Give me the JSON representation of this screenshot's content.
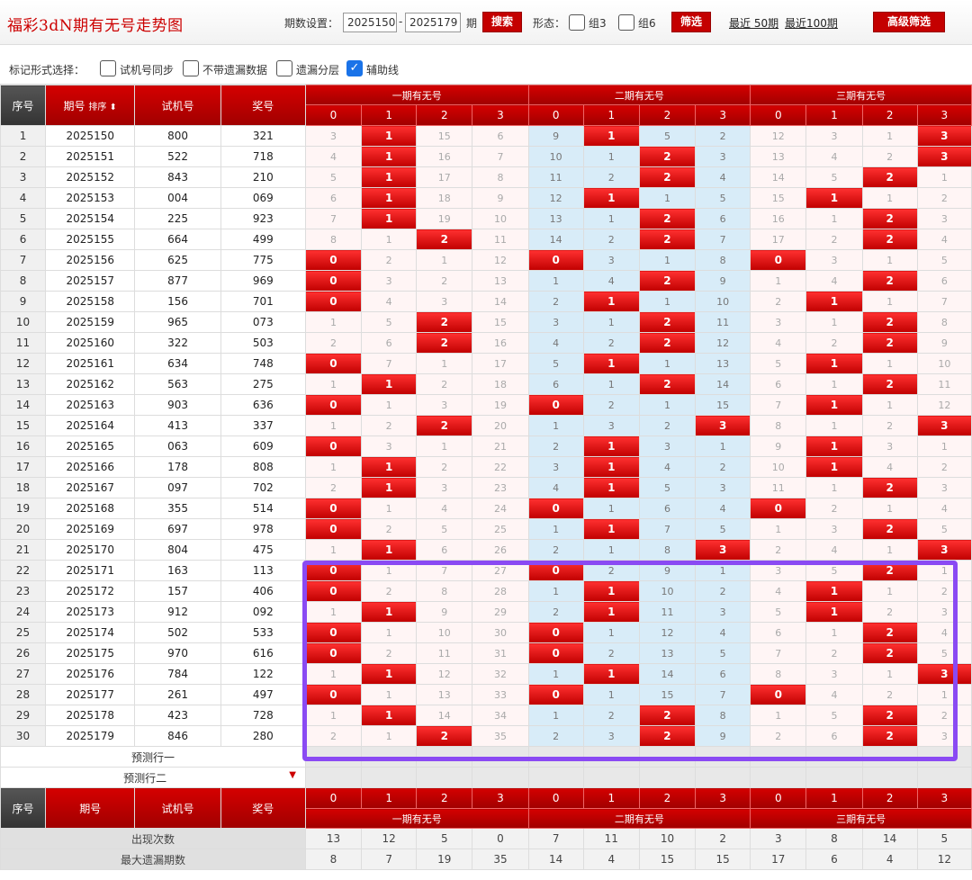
{
  "title": "福彩3dN期有无号走势图",
  "toolbar": {
    "period_label": "期数设置：",
    "from": "2025150",
    "dash": "-",
    "to": "2025179",
    "period_unit": "期",
    "search_label": "搜索",
    "shape_label": "形态：",
    "group3_label": "组3",
    "group6_label": "组6",
    "filter_label": "筛选",
    "recent50_label": "最近 50期",
    "recent100_label": "最近100期",
    "advanced_label": "高级筛选"
  },
  "markbar": {
    "label": "标记形式选择：",
    "options": [
      {
        "label": "试机号同步",
        "checked": false
      },
      {
        "label": "不带遗漏数据",
        "checked": false
      },
      {
        "label": "遗漏分层",
        "checked": false
      },
      {
        "label": "辅助线",
        "checked": true
      }
    ]
  },
  "header": {
    "seq": "序号",
    "period": "期号",
    "sort": "排序",
    "trial": "试机号",
    "prize": "奖号",
    "groups": [
      "一期有无号",
      "二期有无号",
      "三期有无号"
    ],
    "digits": [
      "0",
      "1",
      "2",
      "3"
    ]
  },
  "rows": [
    {
      "seq": "1",
      "period": "2025150",
      "trial": "800",
      "prize": "321",
      "cells": [
        "3",
        "1",
        "15",
        "6",
        "9",
        "1",
        "5",
        "2",
        "12",
        "3",
        "1",
        "3"
      ],
      "hits": [
        1,
        5,
        11
      ]
    },
    {
      "seq": "2",
      "period": "2025151",
      "trial": "522",
      "prize": "718",
      "cells": [
        "4",
        "1",
        "16",
        "7",
        "10",
        "1",
        "2",
        "3",
        "13",
        "4",
        "2",
        "3"
      ],
      "hits": [
        1,
        6,
        11
      ]
    },
    {
      "seq": "3",
      "period": "2025152",
      "trial": "843",
      "prize": "210",
      "cells": [
        "5",
        "1",
        "17",
        "8",
        "11",
        "2",
        "2",
        "4",
        "14",
        "5",
        "2",
        "1"
      ],
      "hits": [
        1,
        6,
        10
      ]
    },
    {
      "seq": "4",
      "period": "2025153",
      "trial": "004",
      "prize": "069",
      "cells": [
        "6",
        "1",
        "18",
        "9",
        "12",
        "1",
        "1",
        "5",
        "15",
        "1",
        "1",
        "2"
      ],
      "hits": [
        1,
        5,
        9
      ]
    },
    {
      "seq": "5",
      "period": "2025154",
      "trial": "225",
      "prize": "923",
      "cells": [
        "7",
        "1",
        "19",
        "10",
        "13",
        "1",
        "2",
        "6",
        "16",
        "1",
        "2",
        "3"
      ],
      "hits": [
        1,
        6,
        10
      ]
    },
    {
      "seq": "6",
      "period": "2025155",
      "trial": "664",
      "prize": "499",
      "cells": [
        "8",
        "1",
        "2",
        "11",
        "14",
        "2",
        "2",
        "7",
        "17",
        "2",
        "2",
        "4"
      ],
      "hits": [
        2,
        6,
        10
      ],
      "grpend": true
    },
    {
      "seq": "7",
      "period": "2025156",
      "trial": "625",
      "prize": "775",
      "cells": [
        "0",
        "2",
        "1",
        "12",
        "0",
        "3",
        "1",
        "8",
        "0",
        "3",
        "1",
        "5"
      ],
      "hits": [
        0,
        4,
        8
      ]
    },
    {
      "seq": "8",
      "period": "2025157",
      "trial": "877",
      "prize": "969",
      "cells": [
        "0",
        "3",
        "2",
        "13",
        "1",
        "4",
        "2",
        "9",
        "1",
        "4",
        "2",
        "6"
      ],
      "hits": [
        0,
        6,
        10
      ]
    },
    {
      "seq": "9",
      "period": "2025158",
      "trial": "156",
      "prize": "701",
      "cells": [
        "0",
        "4",
        "3",
        "14",
        "2",
        "1",
        "1",
        "10",
        "2",
        "1",
        "1",
        "7"
      ],
      "hits": [
        0,
        5,
        9
      ]
    },
    {
      "seq": "10",
      "period": "2025159",
      "trial": "965",
      "prize": "073",
      "cells": [
        "1",
        "5",
        "2",
        "15",
        "3",
        "1",
        "2",
        "11",
        "3",
        "1",
        "2",
        "8"
      ],
      "hits": [
        2,
        6,
        10
      ]
    },
    {
      "seq": "11",
      "period": "2025160",
      "trial": "322",
      "prize": "503",
      "cells": [
        "2",
        "6",
        "2",
        "16",
        "4",
        "2",
        "2",
        "12",
        "4",
        "2",
        "2",
        "9"
      ],
      "hits": [
        2,
        6,
        10
      ]
    },
    {
      "seq": "12",
      "period": "2025161",
      "trial": "634",
      "prize": "748",
      "cells": [
        "0",
        "7",
        "1",
        "17",
        "5",
        "1",
        "1",
        "13",
        "5",
        "1",
        "1",
        "10"
      ],
      "hits": [
        0,
        5,
        9
      ],
      "grpend": true
    },
    {
      "seq": "13",
      "period": "2025162",
      "trial": "563",
      "prize": "275",
      "cells": [
        "1",
        "1",
        "2",
        "18",
        "6",
        "1",
        "2",
        "14",
        "6",
        "1",
        "2",
        "11"
      ],
      "hits": [
        1,
        6,
        10
      ]
    },
    {
      "seq": "14",
      "period": "2025163",
      "trial": "903",
      "prize": "636",
      "cells": [
        "0",
        "1",
        "3",
        "19",
        "0",
        "2",
        "1",
        "15",
        "7",
        "1",
        "1",
        "12"
      ],
      "hits": [
        0,
        4,
        9
      ]
    },
    {
      "seq": "15",
      "period": "2025164",
      "trial": "413",
      "prize": "337",
      "cells": [
        "1",
        "2",
        "2",
        "20",
        "1",
        "3",
        "2",
        "3",
        "8",
        "1",
        "2",
        "3"
      ],
      "hits": [
        2,
        7,
        11
      ]
    },
    {
      "seq": "16",
      "period": "2025165",
      "trial": "063",
      "prize": "609",
      "cells": [
        "0",
        "3",
        "1",
        "21",
        "2",
        "1",
        "3",
        "1",
        "9",
        "1",
        "3",
        "1"
      ],
      "hits": [
        0,
        5,
        9
      ]
    },
    {
      "seq": "17",
      "period": "2025166",
      "trial": "178",
      "prize": "808",
      "cells": [
        "1",
        "1",
        "2",
        "22",
        "3",
        "1",
        "4",
        "2",
        "10",
        "1",
        "4",
        "2"
      ],
      "hits": [
        1,
        5,
        9
      ]
    },
    {
      "seq": "18",
      "period": "2025167",
      "trial": "097",
      "prize": "702",
      "cells": [
        "2",
        "1",
        "3",
        "23",
        "4",
        "1",
        "5",
        "3",
        "11",
        "1",
        "2",
        "3"
      ],
      "hits": [
        1,
        5,
        10
      ],
      "grpend": true
    },
    {
      "seq": "19",
      "period": "2025168",
      "trial": "355",
      "prize": "514",
      "cells": [
        "0",
        "1",
        "4",
        "24",
        "0",
        "1",
        "6",
        "4",
        "0",
        "2",
        "1",
        "4"
      ],
      "hits": [
        0,
        4,
        8
      ]
    },
    {
      "seq": "20",
      "period": "2025169",
      "trial": "697",
      "prize": "978",
      "cells": [
        "0",
        "2",
        "5",
        "25",
        "1",
        "1",
        "7",
        "5",
        "1",
        "3",
        "2",
        "5"
      ],
      "hits": [
        0,
        5,
        10
      ]
    },
    {
      "seq": "21",
      "period": "2025170",
      "trial": "804",
      "prize": "475",
      "cells": [
        "1",
        "1",
        "6",
        "26",
        "2",
        "1",
        "8",
        "3",
        "2",
        "4",
        "1",
        "3"
      ],
      "hits": [
        1,
        7,
        11
      ]
    },
    {
      "seq": "22",
      "period": "2025171",
      "trial": "163",
      "prize": "113",
      "cells": [
        "0",
        "1",
        "7",
        "27",
        "0",
        "2",
        "9",
        "1",
        "3",
        "5",
        "2",
        "1"
      ],
      "hits": [
        0,
        4,
        10
      ]
    },
    {
      "seq": "23",
      "period": "2025172",
      "trial": "157",
      "prize": "406",
      "cells": [
        "0",
        "2",
        "8",
        "28",
        "1",
        "1",
        "10",
        "2",
        "4",
        "1",
        "1",
        "2"
      ],
      "hits": [
        0,
        5,
        9
      ]
    },
    {
      "seq": "24",
      "period": "2025173",
      "trial": "912",
      "prize": "092",
      "cells": [
        "1",
        "1",
        "9",
        "29",
        "2",
        "1",
        "11",
        "3",
        "5",
        "1",
        "2",
        "3"
      ],
      "hits": [
        1,
        5,
        9
      ],
      "grpend": true
    },
    {
      "seq": "25",
      "period": "2025174",
      "trial": "502",
      "prize": "533",
      "cells": [
        "0",
        "1",
        "10",
        "30",
        "0",
        "1",
        "12",
        "4",
        "6",
        "1",
        "2",
        "4"
      ],
      "hits": [
        0,
        4,
        10
      ]
    },
    {
      "seq": "26",
      "period": "2025175",
      "trial": "970",
      "prize": "616",
      "cells": [
        "0",
        "2",
        "11",
        "31",
        "0",
        "2",
        "13",
        "5",
        "7",
        "2",
        "2",
        "5"
      ],
      "hits": [
        0,
        4,
        10
      ]
    },
    {
      "seq": "27",
      "period": "2025176",
      "trial": "784",
      "prize": "122",
      "cells": [
        "1",
        "1",
        "12",
        "32",
        "1",
        "1",
        "14",
        "6",
        "8",
        "3",
        "1",
        "3"
      ],
      "hits": [
        1,
        5,
        11
      ]
    },
    {
      "seq": "28",
      "period": "2025177",
      "trial": "261",
      "prize": "497",
      "cells": [
        "0",
        "1",
        "13",
        "33",
        "0",
        "1",
        "15",
        "7",
        "0",
        "4",
        "2",
        "1"
      ],
      "hits": [
        0,
        4,
        8
      ]
    },
    {
      "seq": "29",
      "period": "2025178",
      "trial": "423",
      "prize": "728",
      "cells": [
        "1",
        "1",
        "14",
        "34",
        "1",
        "2",
        "2",
        "8",
        "1",
        "5",
        "2",
        "2"
      ],
      "hits": [
        1,
        6,
        10
      ]
    },
    {
      "seq": "30",
      "period": "2025179",
      "trial": "846",
      "prize": "280",
      "cells": [
        "2",
        "1",
        "2",
        "35",
        "2",
        "3",
        "2",
        "9",
        "2",
        "6",
        "2",
        "3"
      ],
      "hits": [
        2,
        6,
        10
      ]
    }
  ],
  "prediction": {
    "row1": "预测行一",
    "row2": "预测行二"
  },
  "stats": [
    {
      "label": "出现次数",
      "values": [
        "13",
        "12",
        "5",
        "0",
        "7",
        "11",
        "10",
        "2",
        "3",
        "8",
        "14",
        "5"
      ]
    },
    {
      "label": "最大遗漏期数",
      "values": [
        "8",
        "7",
        "19",
        "35",
        "14",
        "4",
        "15",
        "15",
        "17",
        "6",
        "4",
        "12"
      ]
    }
  ],
  "colors": {
    "accent": "#c40000",
    "hit": "#d00000",
    "group2_bg": "#d8ecf8",
    "selection": "#8a4af3"
  }
}
